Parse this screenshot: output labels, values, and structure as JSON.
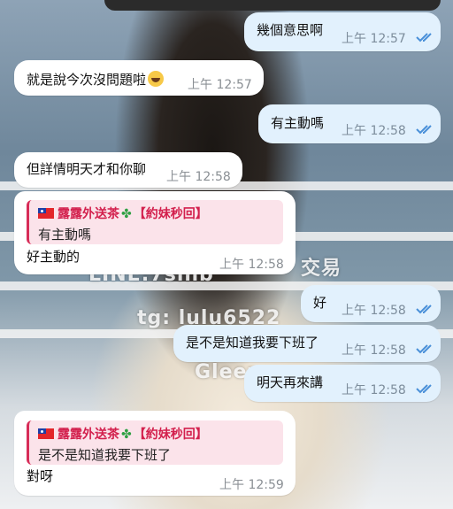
{
  "background": {
    "watermarks": [
      "LINE:7sinb",
      "交易",
      "tg: lulu6522",
      "Gleez"
    ]
  },
  "messages": [
    {
      "text": "幾個意思啊",
      "time": "上午 12:57",
      "direction": "out",
      "read": true
    },
    {
      "text": "就是說今次沒問題啦",
      "emoji": "joy-emoji",
      "time": "上午 12:57",
      "direction": "in"
    },
    {
      "text": "有主動嗎",
      "time": "上午 12:58",
      "direction": "out",
      "read": true
    },
    {
      "text": "但詳情明天才和你聊",
      "time": "上午 12:58",
      "direction": "in"
    },
    {
      "text": "好主動的",
      "time": "上午 12:58",
      "direction": "in",
      "reply": {
        "name": "露露外送茶",
        "name_suffix": "【約妹秒回】",
        "text": "有主動嗎"
      }
    },
    {
      "text": "好",
      "time": "上午 12:58",
      "direction": "out",
      "read": true
    },
    {
      "text": "是不是知道我要下班了",
      "time": "上午 12:58",
      "direction": "out",
      "read": true
    },
    {
      "text": "明天再來講",
      "time": "上午 12:58",
      "direction": "out",
      "read": true
    },
    {
      "text": "對呀",
      "time": "上午 12:59",
      "direction": "in",
      "reply": {
        "name": "露露外送茶",
        "name_suffix": "【約妹秒回】",
        "text": "是不是知道我要下班了"
      }
    }
  ],
  "colors": {
    "incoming_bubble": "#ffffff",
    "outgoing_bubble": "#e2f1fd",
    "reply_accent": "#d72c58",
    "check_color": "#4a90d9"
  }
}
